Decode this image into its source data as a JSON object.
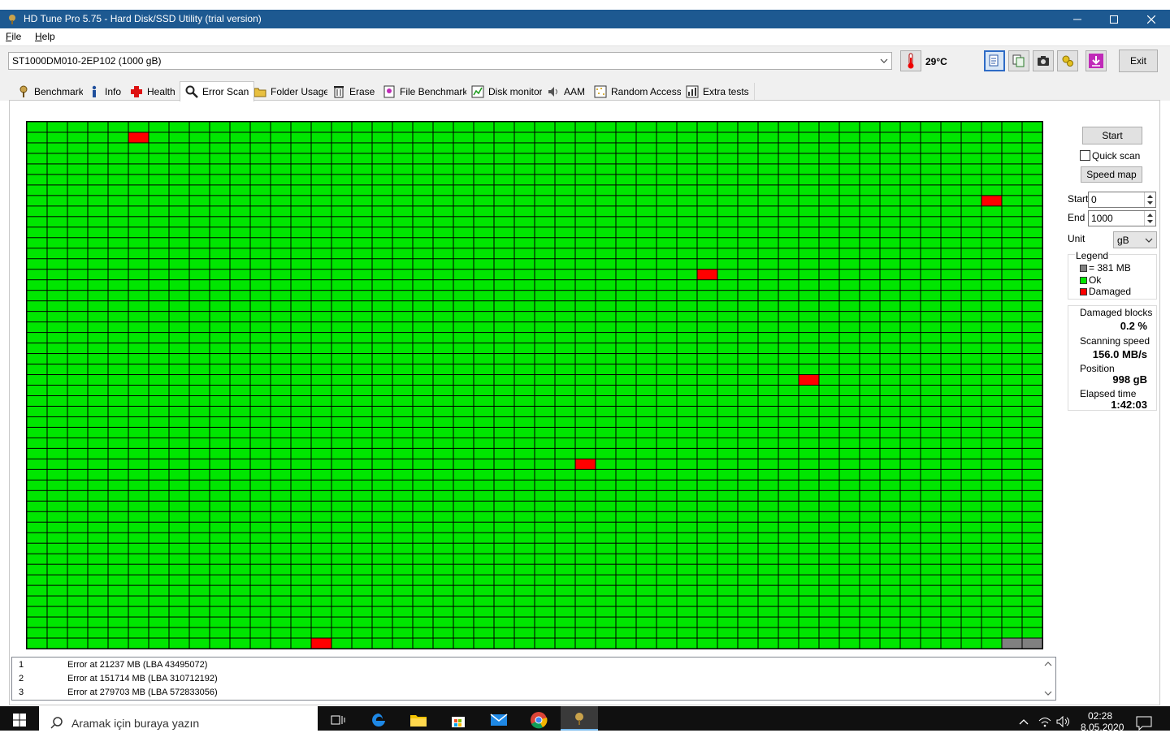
{
  "window": {
    "title": "HD Tune Pro 5.75 - Hard Disk/SSD Utility (trial version)",
    "minimize_icon": "minimize-icon",
    "maximize_icon": "maximize-icon",
    "close_icon": "close-icon"
  },
  "menu": {
    "file": "File",
    "help": "Help"
  },
  "toolbar": {
    "drive": "ST1000DM010-2EP102 (1000 gB)",
    "temperature": "29°C",
    "exit_label": "Exit",
    "icons": [
      "copy-text-icon",
      "copy-info-icon",
      "screenshot-icon",
      "options-icon",
      "save-icon"
    ]
  },
  "tabs": [
    {
      "label": "Benchmark",
      "icon": "benchmark-icon"
    },
    {
      "label": "Info",
      "icon": "info-icon"
    },
    {
      "label": "Health",
      "icon": "health-icon"
    },
    {
      "label": "Error Scan",
      "icon": "error-scan-icon",
      "active": true
    },
    {
      "label": "Folder Usage",
      "icon": "folder-icon"
    },
    {
      "label": "Erase",
      "icon": "erase-icon"
    },
    {
      "label": "File Benchmark",
      "icon": "file-benchmark-icon"
    },
    {
      "label": "Disk monitor",
      "icon": "disk-monitor-icon"
    },
    {
      "label": "AAM",
      "icon": "speaker-icon"
    },
    {
      "label": "Random Access",
      "icon": "random-access-icon"
    },
    {
      "label": "Extra tests",
      "icon": "extra-tests-icon"
    }
  ],
  "scan_map": {
    "columns": 50,
    "rows": 50,
    "colors": {
      "ok": "#00e600",
      "damaged": "#ff0000",
      "unscanned": "#808080"
    },
    "damaged_cells": [
      [
        1,
        5
      ],
      [
        7,
        47
      ],
      [
        14,
        33
      ],
      [
        24,
        38
      ],
      [
        32,
        27
      ],
      [
        49,
        14
      ]
    ],
    "unscanned_cells": [
      [
        49,
        48
      ],
      [
        49,
        49
      ]
    ]
  },
  "controls": {
    "start_button": "Start",
    "quick_scan_label": "Quick scan",
    "quick_scan_checked": false,
    "speed_map_button": "Speed map",
    "start_label": "Start",
    "start_value": "0",
    "end_label": "End",
    "end_value": "1000",
    "unit_label": "Unit",
    "unit_value": "gB"
  },
  "legend": {
    "title": "Legend",
    "block_size": "= 381 MB",
    "ok": "Ok",
    "damaged": "Damaged"
  },
  "stats": {
    "damaged_blocks_label": "Damaged blocks",
    "damaged_blocks_value": "0.2 %",
    "scanning_speed_label": "Scanning speed",
    "scanning_speed_value": "156.0 MB/s",
    "position_label": "Position",
    "position_value": "998 gB",
    "elapsed_label": "Elapsed time",
    "elapsed_value": "1:42:03"
  },
  "errors": [
    {
      "n": "1",
      "text": "Error at 21237 MB (LBA 43495072)"
    },
    {
      "n": "2",
      "text": "Error at 151714 MB (LBA 310712192)"
    },
    {
      "n": "3",
      "text": "Error at 279703 MB (LBA 572833056)"
    }
  ],
  "taskbar": {
    "search_placeholder": "Aramak için buraya yazın",
    "time": "02:28",
    "date": "8.05.2020",
    "apps": [
      "task-view-icon",
      "edge-icon",
      "file-explorer-icon",
      "store-icon",
      "mail-icon",
      "chrome-icon",
      "hdtune-icon"
    ]
  }
}
